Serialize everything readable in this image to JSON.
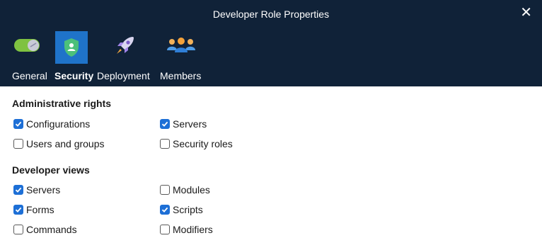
{
  "window": {
    "title": "Developer Role Properties",
    "close_glyph": "✕"
  },
  "tabs": [
    {
      "label": "General",
      "icon": "toggle-switch-icon",
      "active": false
    },
    {
      "label": "Security",
      "icon": "shield-user-icon",
      "active": true
    },
    {
      "label": "Deployment",
      "icon": "rocket-icon",
      "active": false
    },
    {
      "label": "Members",
      "icon": "people-group-icon",
      "active": false
    }
  ],
  "admin": {
    "title": "Administrative rights",
    "items": [
      {
        "label": "Configurations",
        "checked": true
      },
      {
        "label": "Servers",
        "checked": true
      },
      {
        "label": "Users and groups",
        "checked": false
      },
      {
        "label": "Security roles",
        "checked": false
      }
    ]
  },
  "dev": {
    "title": "Developer views",
    "items": [
      {
        "label": "Servers",
        "checked": true
      },
      {
        "label": "Modules",
        "checked": false
      },
      {
        "label": "Forms",
        "checked": true
      },
      {
        "label": "Scripts",
        "checked": true
      },
      {
        "label": "Commands",
        "checked": false
      },
      {
        "label": "Modifiers",
        "checked": false
      }
    ]
  },
  "colors": {
    "header_bg": "#102238",
    "accent": "#1f73c9",
    "checkbox_checked": "#1d6fd6"
  }
}
